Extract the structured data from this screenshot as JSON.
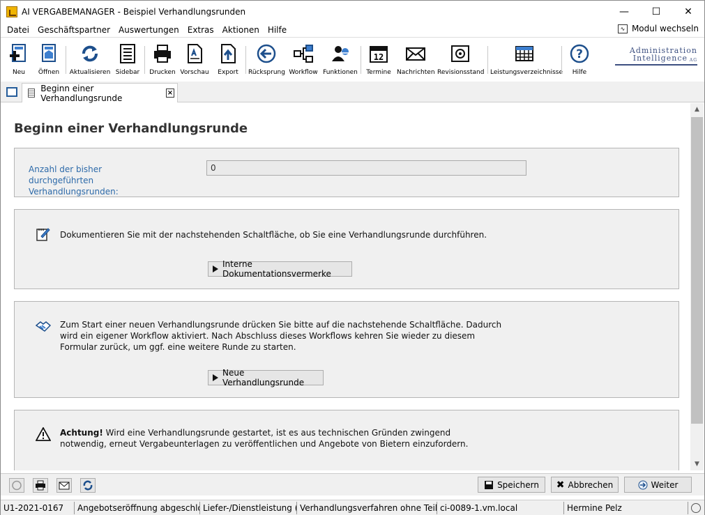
{
  "window": {
    "title": "AI VERGABEMANAGER - Beispiel Verhandlungsrunden"
  },
  "menu": {
    "items": [
      "Datei",
      "Geschäftspartner",
      "Auswertungen",
      "Extras",
      "Aktionen",
      "Hilfe"
    ],
    "modul_wechseln": "Modul wechseln"
  },
  "toolbar": {
    "items": [
      {
        "label": "Neu",
        "icon": "new-document-icon"
      },
      {
        "label": "Öffnen",
        "icon": "open-document-icon"
      },
      {
        "label": "Aktualisieren",
        "icon": "refresh-icon"
      },
      {
        "label": "Sidebar",
        "icon": "sidebar-icon"
      },
      {
        "label": "Drucken",
        "icon": "printer-icon"
      },
      {
        "label": "Vorschau",
        "icon": "preview-icon"
      },
      {
        "label": "Export",
        "icon": "export-icon"
      },
      {
        "label": "Rücksprung",
        "icon": "back-arrow-icon"
      },
      {
        "label": "Workflow",
        "icon": "workflow-icon"
      },
      {
        "label": "Funktionen",
        "icon": "functions-icon"
      },
      {
        "label": "Termine",
        "icon": "calendar-icon"
      },
      {
        "label": "Nachrichten",
        "icon": "envelope-icon"
      },
      {
        "label": "Revisionsstand",
        "icon": "safe-icon"
      },
      {
        "label": "Leistungsverzeichnisse",
        "icon": "grid-table-icon"
      },
      {
        "label": "Hilfe",
        "icon": "help-icon"
      }
    ]
  },
  "logo": {
    "line1": "Administration",
    "line2": "Intelligence",
    "suffix": "AG"
  },
  "tab": {
    "label": "Beginn einer Verhandlungsrunde"
  },
  "page": {
    "title": "Beginn einer Verhandlungsrunde",
    "count_label": "Anzahl der bisher durchgeführten Verhandlungsrunden:",
    "count_value": "0",
    "doc_text": "Dokumentieren Sie mit der nachstehenden Schaltfläche, ob Sie eine Verhandlungsrunde durchführen.",
    "doc_button": "Interne Dokumentationsvermerke",
    "start_text": "Zum Start einer neuen Verhandlungsrunde drücken Sie bitte auf die nachstehende Schaltfläche. Dadurch wird ein eigener Workflow aktiviert. Nach Abschluss dieses Workflows kehren Sie wieder zu diesem Formular zurück, um ggf. eine weitere Runde zu starten.",
    "start_button": "Neue Verhandlungsrunde",
    "warning_bold": "Achtung!",
    "warning_text": " Wird eine Verhandlungsrunde gestartet, ist es aus technischen Gründen zwingend notwendig, erneut Vergabeunterlagen zu veröffentlichen und Angebote von Bietern einzufordern."
  },
  "actions": {
    "save": "Speichern",
    "cancel": "Abbrechen",
    "next": "Weiter"
  },
  "status": {
    "cells": [
      "U1-2021-0167",
      "Angebotseröffnung abgeschlos...",
      "Liefer-/Dienstleistung (...",
      "Verhandlungsverfahren ohne Teiln...",
      "ci-0089-1.vm.local",
      "Hermine Pelz"
    ]
  }
}
